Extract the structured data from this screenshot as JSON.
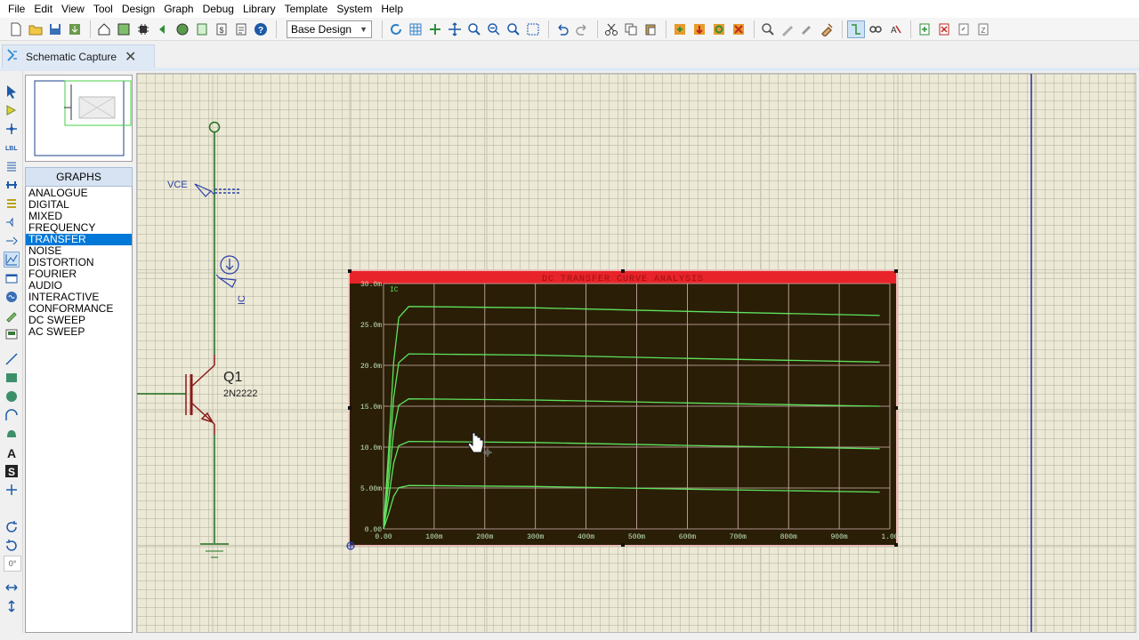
{
  "menu": [
    "File",
    "Edit",
    "View",
    "Tool",
    "Design",
    "Graph",
    "Debug",
    "Library",
    "Template",
    "System",
    "Help"
  ],
  "toolbar": {
    "design_select": "Base Design"
  },
  "tab": {
    "label": "Schematic Capture"
  },
  "graphs_panel": {
    "title": "GRAPHS",
    "items": [
      "ANALOGUE",
      "DIGITAL",
      "MIXED",
      "FREQUENCY",
      "TRANSFER",
      "NOISE",
      "DISTORTION",
      "FOURIER",
      "AUDIO",
      "INTERACTIVE",
      "CONFORMANCE",
      "DC SWEEP",
      "AC SWEEP"
    ],
    "selected": "TRANSFER"
  },
  "schematic": {
    "vce_label": "VCE",
    "ic_label": "IC",
    "transistor_ref": "Q1",
    "transistor_part": "2N2222"
  },
  "graph": {
    "title": "DC TRANSFER CURVE ANALYSIS",
    "trace_label": "IC",
    "colors": {
      "background": "#2a1e06",
      "title_bar": "#e8232a",
      "grid": "#d9b7b7",
      "trace": "#5ee35e",
      "tick_text": "#bfe6bf"
    },
    "chart_data": {
      "type": "line",
      "x_ticks": [
        "0.00",
        "100m",
        "200m",
        "300m",
        "400m",
        "500m",
        "600m",
        "700m",
        "800m",
        "900m",
        "1.00"
      ],
      "y_ticks": [
        "0.00",
        "5.00m",
        "10.0m",
        "15.0m",
        "20.0m",
        "25.0m",
        "30.0m"
      ],
      "xlim": [
        0,
        1.0
      ],
      "ylim": [
        0,
        0.03
      ],
      "series": [
        {
          "plateau_mA": 5.3,
          "end_mA": 4.5
        },
        {
          "plateau_mA": 10.7,
          "end_mA": 9.8
        },
        {
          "plateau_mA": 15.9,
          "end_mA": 15.0
        },
        {
          "plateau_mA": 21.4,
          "end_mA": 20.4
        },
        {
          "plateau_mA": 27.2,
          "end_mA": 26.1
        }
      ]
    }
  }
}
